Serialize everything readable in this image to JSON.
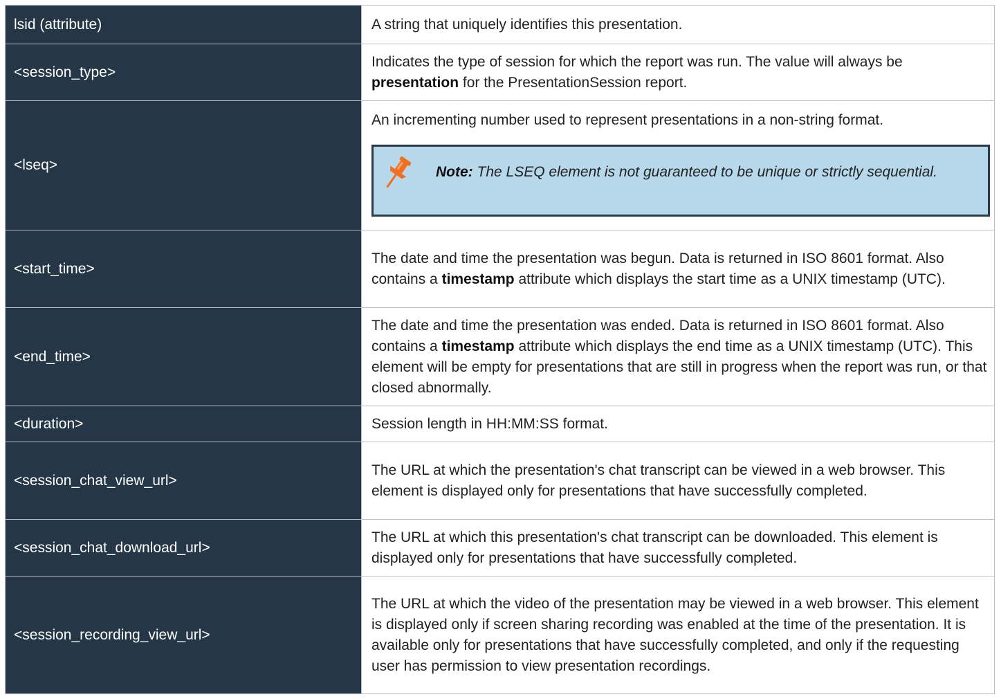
{
  "rows": [
    {
      "name": "lsid (attribute)",
      "desc": "A string that uniquely identifies this presentation."
    },
    {
      "name": "<session_type>",
      "desc_pre": "Indicates the type of session for which the report was run. The value will always be ",
      "desc_bold": "presentation",
      "desc_post": " for the PresentationSession report."
    },
    {
      "name": "<lseq>",
      "desc": "An incrementing number used to represent presentations in a non-string format.",
      "note_label": "Note:",
      "note_text": " The LSEQ element is not guaranteed to be unique or strictly sequential.",
      "note_icon": "pushpin-icon",
      "note_icon_color": "#f26f21"
    },
    {
      "name": "<start_time>",
      "desc_pre": "The date and time the presentation was begun. Data is returned in ISO 8601 format. Also contains a ",
      "desc_bold": "timestamp",
      "desc_post": " attribute which displays the start time as a UNIX timestamp (UTC)."
    },
    {
      "name": "<end_time>",
      "desc_pre": "The date and time the presentation was ended. Data is returned in ISO 8601 format. Also contains a ",
      "desc_bold": "timestamp",
      "desc_post": " attribute which displays the end time as a UNIX timestamp (UTC). This element will be empty for presentations that are still in progress when the report was run, or that closed abnormally."
    },
    {
      "name": "<duration>",
      "desc": "Session length in HH:MM:SS format."
    },
    {
      "name": "<session_chat_view_url>",
      "desc": "The URL at which the presentation's chat transcript can be viewed in a web browser. This element is displayed only for presentations that have successfully completed."
    },
    {
      "name": "<session_chat_download_url>",
      "desc": "The URL at which this presentation's chat transcript can be downloaded. This element is displayed only for presentations that have successfully completed."
    },
    {
      "name": "<session_recording_view_url>",
      "desc": "The URL at which the video of the presentation may be viewed in a web browser. This element is displayed only if screen sharing recording was enabled at the time of the presentation. It is available only for presentations that have successfully completed, and only if the requesting user has permission to view presentation recordings."
    }
  ],
  "colors": {
    "name_cell_bg": "#253646",
    "note_bg": "#b7d7ea",
    "note_border": "#2a3b4b"
  }
}
